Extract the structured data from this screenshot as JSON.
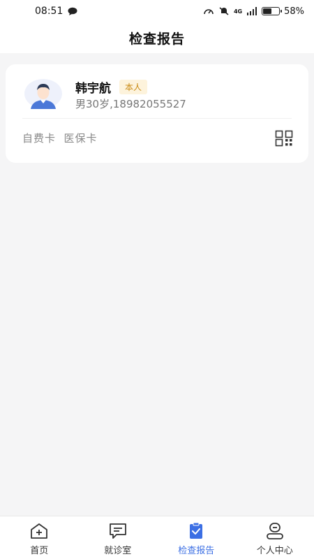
{
  "status_bar": {
    "time": "08:51",
    "network": "4G",
    "battery": "58%",
    "battery_level": 0.58
  },
  "header": {
    "title": "检查报告"
  },
  "patient_card": {
    "name": "韩宇航",
    "relation_badge": "本人",
    "details": "男30岁,18982055527",
    "card_types": "自费卡  医保卡"
  },
  "tabbar": {
    "tabs": [
      {
        "label": "首页",
        "icon": "home-icon"
      },
      {
        "label": "就诊室",
        "icon": "chat-icon"
      },
      {
        "label": "检查报告",
        "icon": "clipboard-check-icon"
      },
      {
        "label": "个人中心",
        "icon": "user-icon"
      }
    ],
    "active_tab": "检查报告",
    "active_color": "#3c6fe4"
  }
}
